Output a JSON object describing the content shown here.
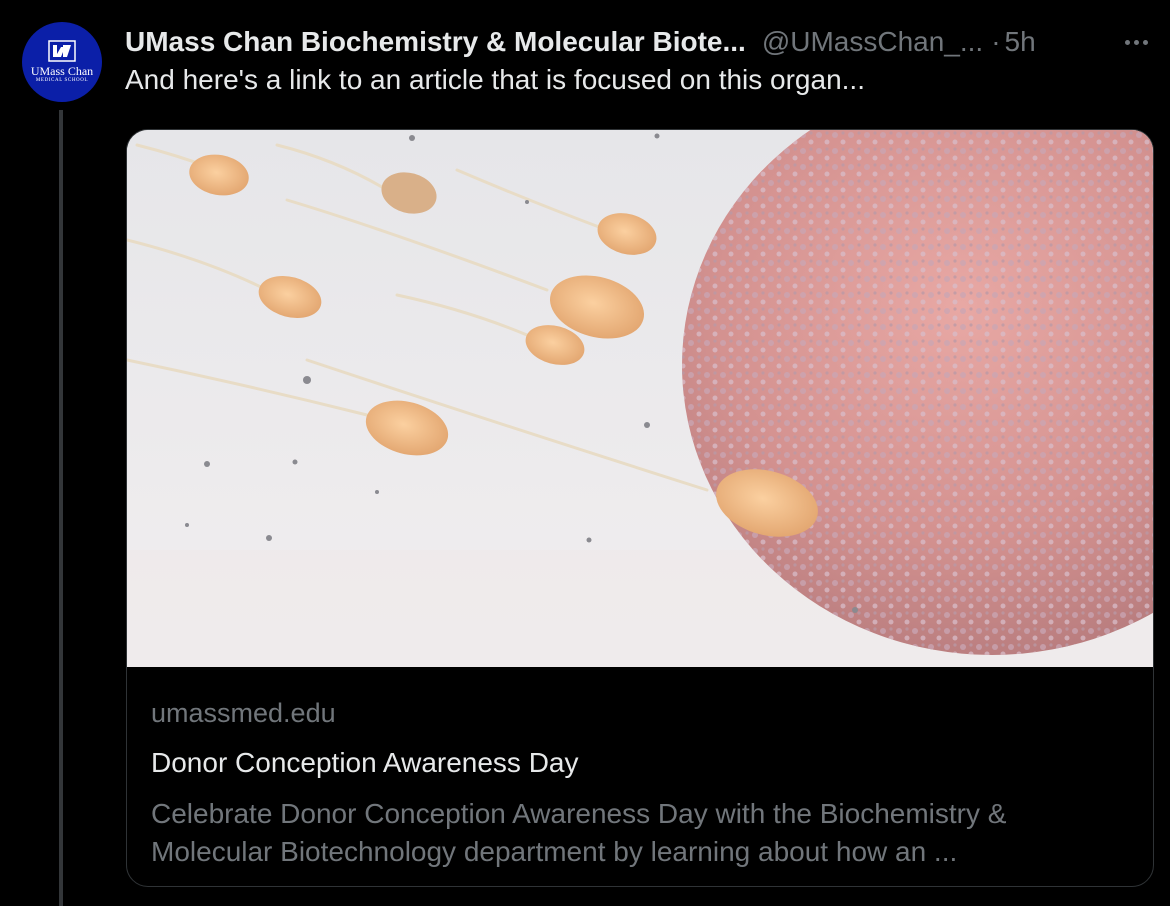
{
  "author": {
    "name": "UMass Chan Biochemistry & Molecular Biote...",
    "handle": "@UMassChan_...",
    "separator": "·",
    "time": "5h",
    "avatar_logo_text": "UMass Chan",
    "avatar_logo_subtext": "MEDICAL SCHOOL"
  },
  "tweet": {
    "text": "And here's a link to an article that is focused on this organ..."
  },
  "card": {
    "domain": "umassmed.edu",
    "title": "Donor Conception Awareness Day",
    "description": "Celebrate Donor Conception Awareness Day with the Biochemistry & Molecular Biotechnology department by learning about how an ..."
  },
  "icons": {
    "more": "more-horizontal-icon"
  },
  "colors": {
    "background": "#000000",
    "text_primary": "#e7e9ea",
    "text_secondary": "#71767b",
    "border": "#2f3336",
    "avatar_bg": "#0b1fa8"
  }
}
